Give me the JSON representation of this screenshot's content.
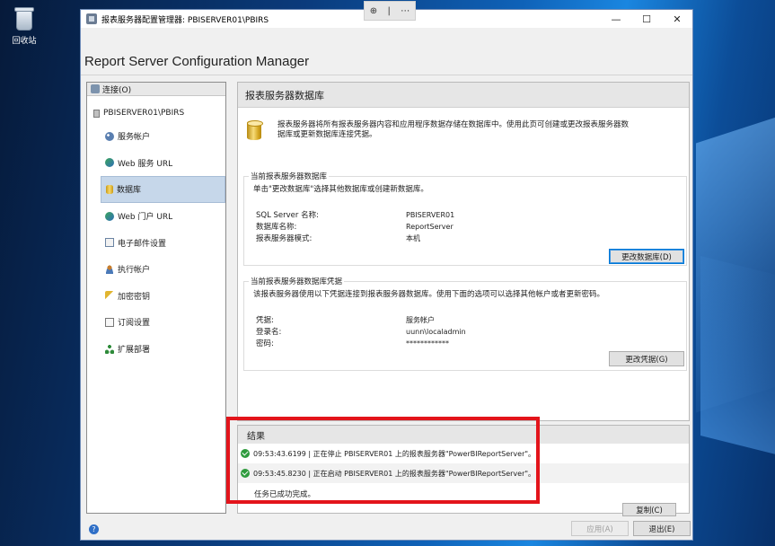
{
  "desktop": {
    "recycle_bin_label": "回收站"
  },
  "window": {
    "title": "报表服务器配置管理器: PBISERVER01\\PBIRS",
    "controls": {
      "minimize": "—",
      "maximize": "☐",
      "close": "✕"
    },
    "floatbar": {
      "zoom": "⊕",
      "sep": "|",
      "more": "⋯"
    }
  },
  "header": {
    "app_title": "Report Server Configuration Manager"
  },
  "sidebar": {
    "connect_label": "连接(O)",
    "server_label": "PBISERVER01\\PBIRS",
    "items": [
      {
        "label": "服务帐户",
        "icon": "service-account-icon"
      },
      {
        "label": "Web 服务 URL",
        "icon": "web-service-icon"
      },
      {
        "label": "数据库",
        "icon": "database-icon",
        "selected": true
      },
      {
        "label": "Web 门户 URL",
        "icon": "web-portal-icon"
      },
      {
        "label": "电子邮件设置",
        "icon": "email-icon"
      },
      {
        "label": "执行帐户",
        "icon": "execution-account-icon"
      },
      {
        "label": "加密密钥",
        "icon": "encryption-key-icon"
      },
      {
        "label": "订阅设置",
        "icon": "subscription-icon"
      },
      {
        "label": "扩展部署",
        "icon": "scale-out-icon"
      }
    ]
  },
  "main": {
    "title": "报表服务器数据库",
    "intro_line1": "报表服务器将所有报表服务器内容和应用程序数据存储在数据库中。使用此页可创建或更改报表服务器数",
    "intro_line2": "据库或更新数据库连接凭据。",
    "db_group": {
      "legend": "当前报表服务器数据库",
      "desc": "单击\"更改数据库\"选择其他数据库或创建新数据库。",
      "rows": [
        {
          "key": "SQL Server 名称:",
          "value": "PBISERVER01"
        },
        {
          "key": "数据库名称:",
          "value": "ReportServer"
        },
        {
          "key": "报表服务器模式:",
          "value": "本机"
        }
      ],
      "button": "更改数据库(D)"
    },
    "cred_group": {
      "legend": "当前报表服务器数据库凭据",
      "desc": "该报表服务器使用以下凭据连接到报表服务器数据库。使用下面的选项可以选择其他帐户或者更新密码。",
      "rows": [
        {
          "key": "凭据:",
          "value": "服务帐户"
        },
        {
          "key": "登录名:",
          "value": "uunn\\localadmin"
        },
        {
          "key": "密码:",
          "value": "************"
        }
      ],
      "button": "更改凭据(G)"
    }
  },
  "results": {
    "title": "结果",
    "rows": [
      "09:53:43.6199 | 正在停止 PBISERVER01 上的报表服务器\"PowerBIReportServer\"。",
      "09:53:45.8230 | 正在启动 PBISERVER01 上的报表服务器\"PowerBIReportServer\"。"
    ],
    "done": "任务已成功完成。",
    "copy_button": "复制(C)"
  },
  "footer": {
    "help": "?",
    "apply_button": "应用(A)",
    "exit_button": "退出(E)"
  },
  "colors": {
    "highlight": "#e3141b",
    "selected_bg": "#c6d7ea",
    "success": "#2f9b3e"
  }
}
